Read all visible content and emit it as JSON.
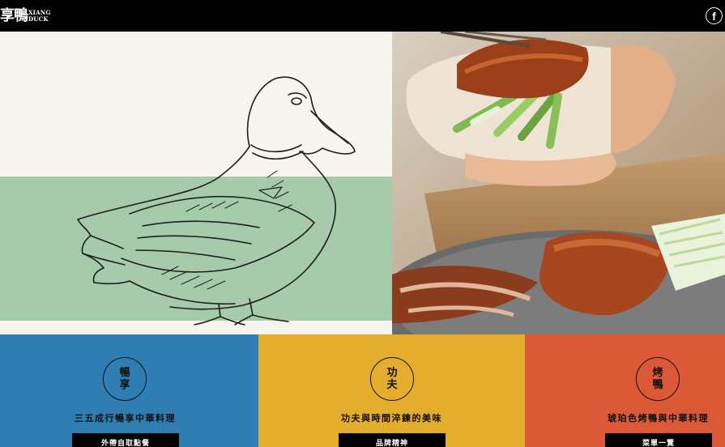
{
  "header": {
    "logo_cjk": "享鴨",
    "logo_latin_top": "XIANG",
    "logo_latin_bottom": "DUCK",
    "facebook_icon": "facebook-icon"
  },
  "colors": {
    "blue_panel": "#2e7db3",
    "yellow_panel": "#e4ad2d",
    "red_panel": "#dc5938",
    "hero_cream": "#f7f5ee",
    "hero_green": "#a6cbab"
  },
  "panels": [
    {
      "badge": [
        "暢",
        "享"
      ],
      "tagline": "三五成行暢享中華料理",
      "button": "外帶自取點餐"
    },
    {
      "badge": [
        "功",
        "夫"
      ],
      "tagline": "功夫與時間淬鍊的美味",
      "button": "品牌精神"
    },
    {
      "badge": [
        "烤",
        "鴨"
      ],
      "tagline": "琥珀色烤鴨與中華料理",
      "button": "菜單一覽"
    }
  ]
}
